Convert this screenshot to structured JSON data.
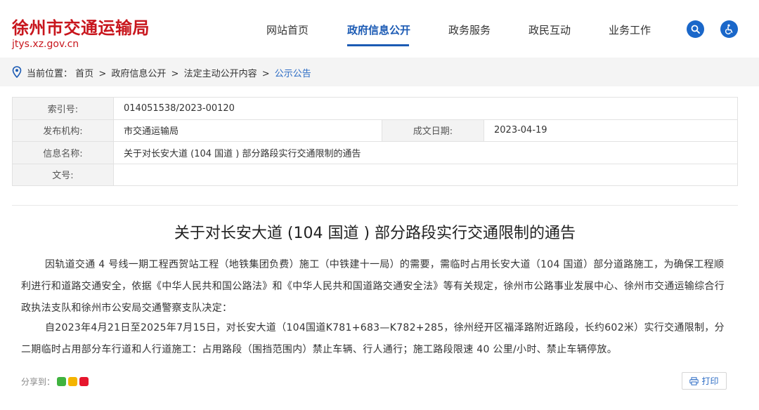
{
  "header": {
    "site_title": "徐州市交通运输局",
    "site_url": "jtys.xz.gov.cn",
    "nav": [
      {
        "label": "网站首页",
        "active": false
      },
      {
        "label": "政府信息公开",
        "active": true
      },
      {
        "label": "政务服务",
        "active": false
      },
      {
        "label": "政民互动",
        "active": false
      },
      {
        "label": "业务工作",
        "active": false
      }
    ],
    "icons": [
      "search-icon",
      "accessibility-icon"
    ],
    "accent_color": "#c8161d",
    "nav_active_color": "#1c5bb4"
  },
  "breadcrumb": {
    "prefix": "当前位置：",
    "items": [
      "首页",
      "政府信息公开",
      "法定主动公开内容",
      "公示公告"
    ],
    "separator": ">"
  },
  "info": {
    "index_label": "索引号:",
    "index_value": "014051538/2023-00120",
    "publisher_label": "发布机构:",
    "publisher_value": "市交通运输局",
    "date_label": "成文日期:",
    "date_value": "2023-04-19",
    "name_label": "信息名称:",
    "name_value": "关于对长安大道 (104 国道 ) 部分路段实行交通限制的通告",
    "docno_label": "文号:",
    "docno_value": ""
  },
  "article": {
    "title": "关于对长安大道 (104 国道 ) 部分路段实行交通限制的通告",
    "paragraphs": [
      "因轨道交通 4 号线一期工程西贺站工程（地铁集团负费）施工（中铁建十一局）的需要，需临时占用长安大道（104 国道）部分道路施工，为确保工程顺利进行和道路交通安全，依据《中华人民共和国公路法》和《中华人民共和国道路交通安全法》等有关规定，徐州市公路事业发展中心、徐州市交通运输综合行政执法支队和徐州市公安局交通警察支队决定：",
      "自2023年4月21日至2025年7月15日，对长安大道（104国道K781+683—K782+285，徐州经开区福泽路附近路段，长约602米）实行交通限制，分二期临时占用部分车行道和人行道施工：占用路段（围挡范围内）禁止车辆、行人通行；施工路段限速 40 公里/小时、禁止车辆停放。"
    ]
  },
  "footer": {
    "share_label": "分享到：",
    "share_icons": [
      "wechat-share-icon",
      "qzone-share-icon",
      "weibo-share-icon"
    ],
    "print_label": "打印"
  }
}
